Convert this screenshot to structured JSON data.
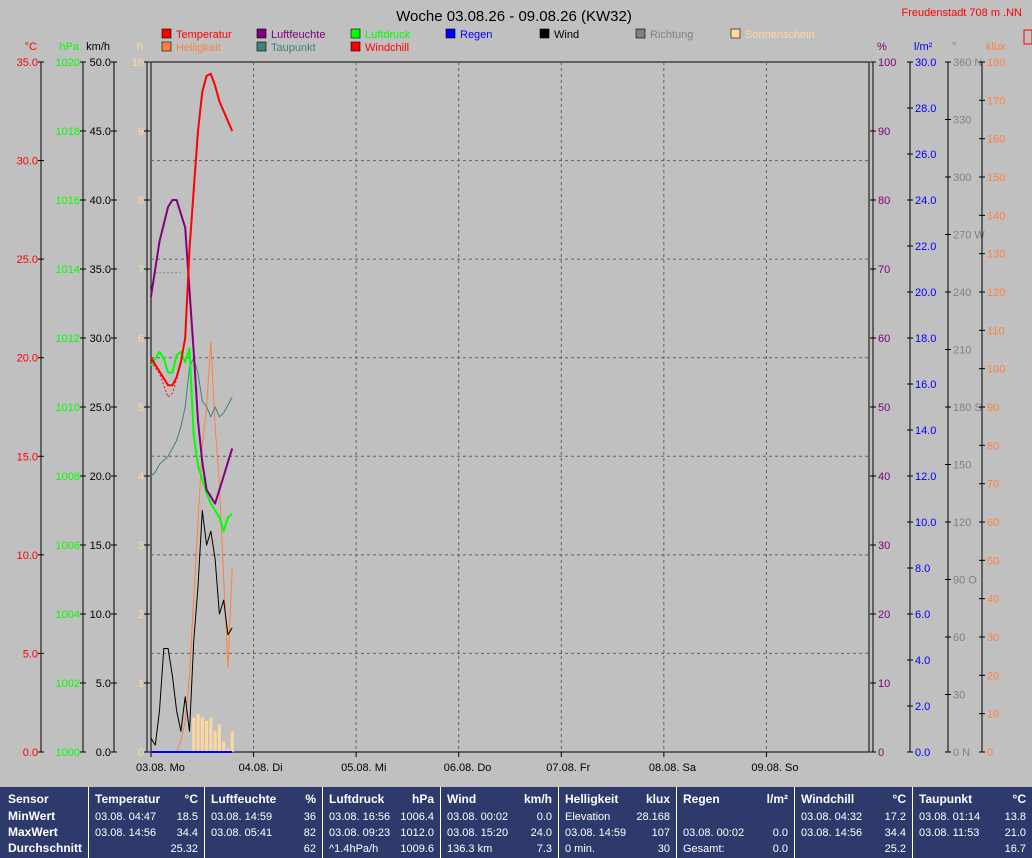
{
  "chart_data": {
    "type": "line",
    "title": "Woche 03.08.26 - 09.08.26 (KW32)",
    "location": "Freudenstadt 708 m  .NN",
    "x_range": [
      "03.08. 00:00",
      "10.08. 00:00"
    ],
    "x_ticks": [
      "03.08.  Mo",
      "04.08.  Di",
      "05.08.  Mi",
      "06.08.  Do",
      "07.08.  Fr",
      "08.08.  Sa",
      "09.08.  So"
    ],
    "grid": true,
    "legend": [
      {
        "name": "Temperatur",
        "color": "#ff0000"
      },
      {
        "name": "Helligkeit",
        "color": "#ff8040"
      },
      {
        "name": "Luftfeuchte",
        "color": "#800080"
      },
      {
        "name": "Taupunkt",
        "color": "#408080"
      },
      {
        "name": "Luftdruck",
        "color": "#00ff00"
      },
      {
        "name": "Windchill",
        "color": "#ff0000"
      },
      {
        "name": "Regen",
        "color": "#0000ff"
      },
      {
        "name": "Wind",
        "color": "#000000"
      },
      {
        "name": "Richtung",
        "color": "#808080"
      },
      {
        "name": "Sonnenschein",
        "color": "#ffd8a0"
      }
    ],
    "axes": {
      "left": [
        {
          "unit": "°C",
          "color": "#ff0000",
          "ticks": [
            "0.0",
            "5.0",
            "10.0",
            "15.0",
            "20.0",
            "25.0",
            "30.0",
            "35.0"
          ]
        },
        {
          "unit": "hPa",
          "color": "#00ff00",
          "ticks": [
            "1000",
            "1002",
            "1004",
            "1006",
            "1008",
            "1010",
            "1012",
            "1014",
            "1016",
            "1018",
            "1020"
          ]
        },
        {
          "unit": "km/h",
          "color": "#000000",
          "ticks": [
            "0.0",
            "5.0",
            "10.0",
            "15.0",
            "20.0",
            "25.0",
            "30.0",
            "35.0",
            "40.0",
            "45.0",
            "50.0"
          ]
        },
        {
          "unit": "h",
          "color": "#ffd8a0",
          "ticks": [
            "0",
            "1",
            "2",
            "3",
            "4",
            "5",
            "6",
            "7",
            "8",
            "9",
            "10"
          ]
        }
      ],
      "right": [
        {
          "unit": "%",
          "color": "#800080",
          "ticks": [
            "0",
            "10",
            "20",
            "30",
            "40",
            "50",
            "60",
            "70",
            "80",
            "90",
            "100"
          ]
        },
        {
          "unit": "l/m²",
          "color": "#0000ff",
          "ticks": [
            "0.0",
            "2.0",
            "4.0",
            "6.0",
            "8.0",
            "10.0",
            "12.0",
            "14.0",
            "16.0",
            "18.0",
            "20.0",
            "22.0",
            "24.0",
            "26.0",
            "28.0",
            "30.0"
          ]
        },
        {
          "unit": "°",
          "color": "#808080",
          "ticks": [
            "0  N",
            "30",
            "60",
            "90  O",
            "120",
            "150",
            "180  S",
            "210",
            "240",
            "270  W",
            "300",
            "330",
            "360  N"
          ]
        },
        {
          "unit": "klux",
          "color": "#ff8040",
          "ticks": [
            "0",
            "10",
            "20",
            "30",
            "40",
            "50",
            "60",
            "70",
            "80",
            "90",
            "100",
            "110",
            "120",
            "130",
            "140",
            "150",
            "160",
            "170",
            "180"
          ]
        }
      ]
    },
    "series": [
      {
        "name": "Temperatur",
        "unit": "°C",
        "x_hours": [
          0,
          2,
          4,
          5,
          6,
          7,
          8,
          9,
          10,
          11,
          12,
          13,
          14,
          15,
          16,
          17,
          18,
          19
        ],
        "values": [
          20.0,
          19.3,
          18.6,
          18.6,
          19.0,
          19.8,
          21.0,
          25.5,
          28.5,
          31.5,
          33.5,
          34.3,
          34.4,
          33.8,
          33.0,
          32.5,
          32.0,
          31.5
        ]
      },
      {
        "name": "Windchill",
        "unit": "°C",
        "x_hours": [
          0,
          2,
          4,
          5,
          6,
          7,
          8,
          9,
          10,
          11,
          12,
          13,
          14,
          15,
          16,
          17,
          18,
          19
        ],
        "values": [
          19.8,
          19.2,
          18.0,
          18.2,
          18.9,
          19.7,
          21.0,
          25.5,
          28.5,
          31.5,
          33.5,
          34.3,
          34.4,
          33.8,
          33.0,
          32.5,
          32.0,
          31.5
        ]
      },
      {
        "name": "Luftfeuchte",
        "unit": "%",
        "x_hours": [
          0,
          2,
          4,
          5,
          6,
          8,
          10,
          11,
          12,
          13,
          14,
          15,
          16,
          17,
          18,
          19
        ],
        "values": [
          66,
          74,
          79,
          80,
          80,
          76,
          58,
          48,
          42,
          38,
          37,
          36,
          38,
          40,
          42,
          44
        ]
      },
      {
        "name": "Luftdruck",
        "unit": "hPa",
        "x_hours": [
          0,
          1,
          2,
          3,
          4,
          5,
          6,
          7,
          8,
          9,
          10,
          11,
          12,
          13,
          14,
          15,
          16,
          17,
          18,
          19
        ],
        "values": [
          1011.2,
          1011.4,
          1011.6,
          1011.4,
          1011.0,
          1011.0,
          1011.5,
          1011.6,
          1011.3,
          1011.7,
          1009.2,
          1008.3,
          1007.9,
          1007.5,
          1007.2,
          1007.0,
          1006.8,
          1006.4,
          1006.8,
          1006.9
        ]
      },
      {
        "name": "Taupunkt",
        "unit": "°C",
        "x_hours": [
          0,
          1,
          2,
          3,
          4,
          5,
          6,
          7,
          8,
          9,
          10,
          11,
          12,
          13,
          14,
          15,
          16,
          17,
          18,
          19
        ],
        "values": [
          14.0,
          14.2,
          14.6,
          14.8,
          15.0,
          15.4,
          15.8,
          16.5,
          17.5,
          19.5,
          20.0,
          19.2,
          17.8,
          17.5,
          17.0,
          17.5,
          17.0,
          17.2,
          17.6,
          18.0
        ]
      },
      {
        "name": "Wind",
        "unit": "km/h",
        "x_hours": [
          0,
          1,
          2,
          3,
          4,
          5,
          6,
          7,
          8,
          9,
          10,
          11,
          12,
          13,
          14,
          15,
          16,
          17,
          18,
          19
        ],
        "values": [
          1.0,
          0.5,
          3.0,
          7.5,
          7.5,
          5.5,
          3.0,
          1.5,
          4.0,
          1.5,
          8.0,
          12.0,
          17.5,
          15.0,
          16.0,
          14.0,
          10.0,
          11.0,
          8.5,
          9.0
        ]
      },
      {
        "name": "Helligkeit",
        "unit": "klux",
        "x_hours": [
          0,
          6,
          7,
          8,
          9,
          10,
          11,
          12,
          13,
          14,
          15,
          16,
          17,
          18,
          19
        ],
        "values": [
          0,
          0,
          3,
          8,
          20,
          40,
          60,
          80,
          90,
          107,
          85,
          70,
          45,
          22,
          48
        ]
      },
      {
        "name": "Regen",
        "unit": "l/m²",
        "x_hours": [
          0,
          19
        ],
        "values": [
          0.0,
          0.0
        ]
      },
      {
        "name": "Richtung",
        "unit": "°",
        "x_hours": [
          1,
          2,
          3,
          4,
          5,
          6,
          7
        ],
        "values": [
          250,
          250,
          250,
          250,
          250,
          250,
          250
        ]
      }
    ],
    "sunshine": {
      "name": "Sonnenschein",
      "unit": "h",
      "x_hours": [
        10,
        11,
        12,
        13,
        14,
        15,
        16,
        17,
        18,
        19
      ],
      "values": [
        0.5,
        0.55,
        0.5,
        0.45,
        0.5,
        0.3,
        0.4,
        0.15,
        0.05,
        0.3
      ]
    }
  },
  "stats": {
    "sensor": {
      "header": "Sensor",
      "rows": [
        "MinWert",
        "MaxWert",
        "Durchschnitt"
      ]
    },
    "columns": [
      {
        "name": "Temperatur",
        "unit": "°C",
        "rows": [
          [
            "03.08.  04:47",
            "18.5"
          ],
          [
            "03.08.  14:56",
            "34.4"
          ],
          [
            "",
            "25.32"
          ]
        ]
      },
      {
        "name": "Luftfeuchte",
        "unit": "%",
        "rows": [
          [
            "03.08.  14:59",
            "36"
          ],
          [
            "03.08.  05:41",
            "82"
          ],
          [
            "",
            "62"
          ]
        ]
      },
      {
        "name": "Luftdruck",
        "unit": "hPa",
        "rows": [
          [
            "03.08.  16:56",
            "1006.4"
          ],
          [
            "03.08.  09:23",
            "1012.0"
          ],
          [
            "^1.4hPa/h",
            "1009.6"
          ]
        ]
      },
      {
        "name": "Wind",
        "unit": "km/h",
        "rows": [
          [
            "03.08.  00:02",
            "0.0"
          ],
          [
            "03.08.  15:20",
            "24.0"
          ],
          [
            "136.3 km",
            "7.3"
          ]
        ]
      },
      {
        "name": "Helligkeit",
        "unit": "klux",
        "rows": [
          [
            "Elevation",
            "28.168"
          ],
          [
            "03.08.  14:59",
            "107"
          ],
          [
            "0 min.",
            "30"
          ]
        ]
      },
      {
        "name": "Regen",
        "unit": "l/m²",
        "rows": [
          [
            "",
            ""
          ],
          [
            "03.08.  00:02",
            "0.0"
          ],
          [
            "Gesamt:",
            "0.0"
          ]
        ]
      },
      {
        "name": "Windchill",
        "unit": "°C",
        "rows": [
          [
            "03.08.  04:32",
            "17.2"
          ],
          [
            "03.08.  14:56",
            "34.4"
          ],
          [
            "",
            "25.2"
          ]
        ]
      },
      {
        "name": "Taupunkt",
        "unit": "°C",
        "rows": [
          [
            "03.08.  01:14",
            "13.8"
          ],
          [
            "03.08.  11:53",
            "21.0"
          ],
          [
            "",
            "16.7"
          ]
        ]
      }
    ]
  }
}
